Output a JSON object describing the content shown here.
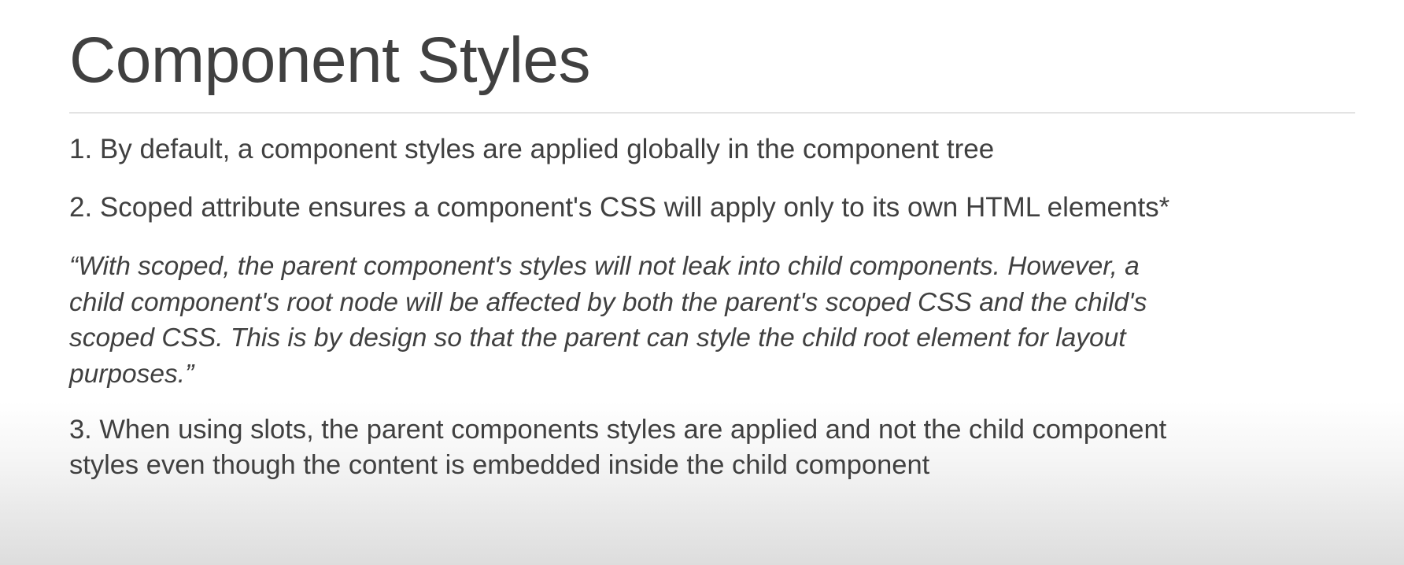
{
  "slide": {
    "title": "Component Styles",
    "points": [
      "1. By default, a component styles are applied globally in the component tree",
      "2. Scoped attribute ensures a component's CSS will apply only to its own HTML elements*"
    ],
    "quote_lines": [
      "“With scoped, the parent component's styles will not leak into child components. However, a",
      "child component's root node will be affected by both the parent's scoped CSS and the child's",
      "scoped CSS. This is by design so that the parent can style the child root element for layout",
      "purposes.”"
    ],
    "point3_lines": [
      "3. When using slots, the parent components styles are applied and not the child component",
      "styles even though the content is embedded inside the child component"
    ]
  },
  "colors": {
    "text": "#404040",
    "rule": "#c3c3c3",
    "background": "#ffffff"
  }
}
